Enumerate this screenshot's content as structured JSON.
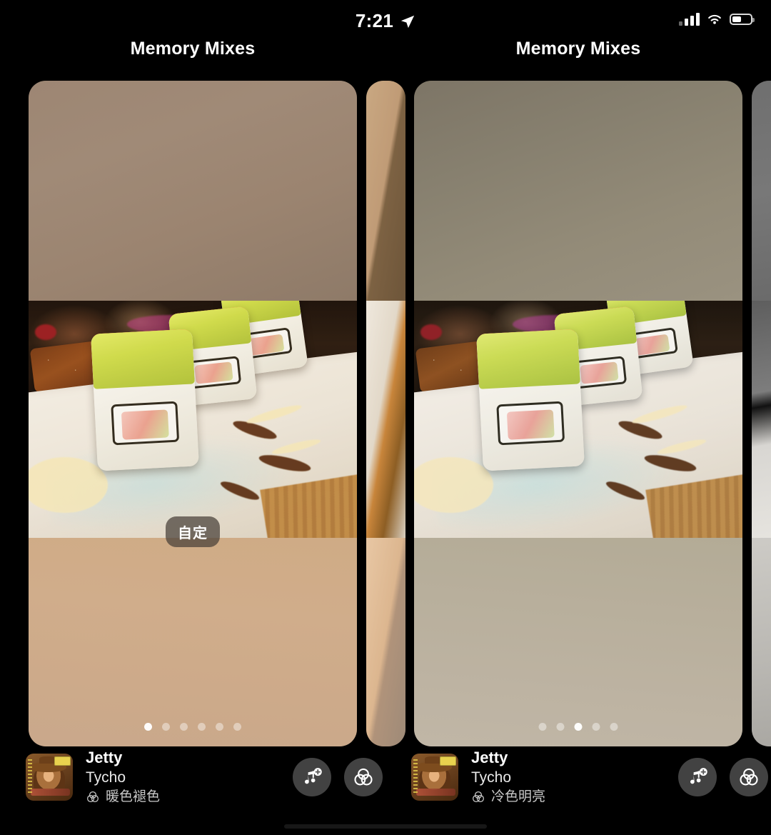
{
  "status_bar": {
    "time": "7:21",
    "location_icon": "location-arrow-icon",
    "cellular_icon": "cellular-signal-icon",
    "wifi_icon": "wifi-icon",
    "battery_icon": "battery-icon",
    "battery_level_percent": 52
  },
  "cards": [
    {
      "title": "Memory Mixes",
      "custom_badge": "自定",
      "page_dots": {
        "count": 6,
        "active_index": 0
      },
      "now_playing": {
        "song": "Jetty",
        "artist": "Tycho",
        "filter_name": "暖色褪色",
        "filter_icon": "color-filter-icon",
        "album_art": "album-art-jetty"
      },
      "actions": [
        {
          "name": "add-music-button",
          "icon": "music-note-plus-icon"
        },
        {
          "name": "filter-button",
          "icon": "color-filter-icon"
        }
      ]
    },
    {
      "title": "Memory Mixes",
      "page_dots": {
        "count": 5,
        "active_index": 2
      },
      "now_playing": {
        "song": "Jetty",
        "artist": "Tycho",
        "filter_name": "冷色明亮",
        "filter_icon": "color-filter-icon",
        "album_art": "album-art-jetty"
      },
      "actions": [
        {
          "name": "add-music-button",
          "icon": "music-note-plus-icon"
        },
        {
          "name": "filter-button",
          "icon": "color-filter-icon"
        }
      ]
    }
  ],
  "photo": {
    "subject": "sushi-roll-platter",
    "description": "Close-up of sushi rolls topped with orange tobiko roe and avocado on a white ceramic plate with sauce drizzles"
  },
  "colors": {
    "background": "#000000",
    "title_text": "#ffffff",
    "pill_bg": "rgba(70,62,56,0.72)",
    "dot_active": "#ffffff",
    "dot_inactive": "rgba(255,255,255,0.42)",
    "warm_accent": "#cfab85",
    "cool_accent": "#b6ae9b"
  }
}
